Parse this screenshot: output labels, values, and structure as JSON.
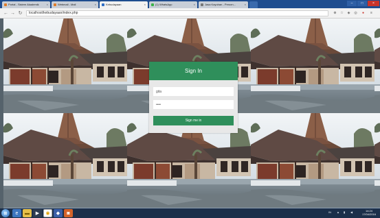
{
  "browser": {
    "tabs": [
      {
        "label": "Portal - Sistem Akademik",
        "color": "#e07b27"
      },
      {
        "label": "Webmail - Mail",
        "color": "#e07b27"
      },
      {
        "label": "Kebudayaan",
        "color": "#2e6dc4"
      },
      {
        "label": "(1) WhatsApp",
        "color": "#3bb34a"
      },
      {
        "label": "Jasa Kayuhan - Pencrn...",
        "color": "#777777"
      }
    ],
    "active_tab_index": 2,
    "url": "localhost/kebudayaan/index.php"
  },
  "login": {
    "title": "Sign In",
    "username_value": "gita",
    "password_value": "••••",
    "submit_label": "Sign me in"
  },
  "taskbar": {
    "clock_time": "14:24",
    "clock_date": "17/04/2016"
  }
}
